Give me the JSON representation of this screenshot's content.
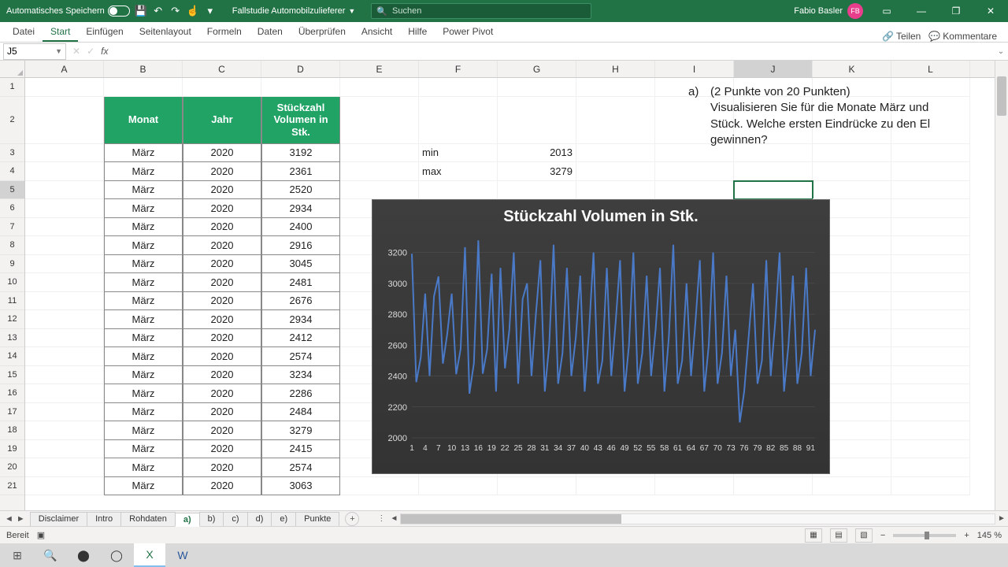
{
  "titlebar": {
    "autosave_label": "Automatisches Speichern",
    "doc_name": "Fallstudie Automobilzulieferer",
    "search_placeholder": "Suchen",
    "user_name": "Fabio Basler",
    "user_initials": "FB"
  },
  "ribbon": {
    "tabs": [
      "Datei",
      "Start",
      "Einfügen",
      "Seitenlayout",
      "Formeln",
      "Daten",
      "Überprüfen",
      "Ansicht",
      "Hilfe",
      "Power Pivot"
    ],
    "share": "Teilen",
    "comments": "Kommentare"
  },
  "formula": {
    "name_box": "J5",
    "value": ""
  },
  "columns": [
    {
      "l": "A",
      "w": 100
    },
    {
      "l": "B",
      "w": 100
    },
    {
      "l": "C",
      "w": 100
    },
    {
      "l": "D",
      "w": 100
    },
    {
      "l": "E",
      "w": 100
    },
    {
      "l": "F",
      "w": 100
    },
    {
      "l": "G",
      "w": 100
    },
    {
      "l": "H",
      "w": 100
    },
    {
      "l": "I",
      "w": 100
    },
    {
      "l": "J",
      "w": 100
    },
    {
      "l": "K",
      "w": 100
    },
    {
      "l": "L",
      "w": 100
    }
  ],
  "headers": {
    "b": "Monat",
    "c": "Jahr",
    "d": "Stückzahl Volumen in Stk."
  },
  "stats": {
    "min_label": "min",
    "min_val": "2013",
    "max_label": "max",
    "max_val": "3279"
  },
  "question": {
    "marker": "a)",
    "line1": "(2 Punkte von 20 Punkten)",
    "line2": "Visualisieren Sie für die Monate März und",
    "line3": "Stück. Welche ersten Eindrücke zu den El",
    "line4": "gewinnen?"
  },
  "table_rows": [
    {
      "m": "März",
      "j": "2020",
      "v": "3192"
    },
    {
      "m": "März",
      "j": "2020",
      "v": "2361"
    },
    {
      "m": "März",
      "j": "2020",
      "v": "2520"
    },
    {
      "m": "März",
      "j": "2020",
      "v": "2934"
    },
    {
      "m": "März",
      "j": "2020",
      "v": "2400"
    },
    {
      "m": "März",
      "j": "2020",
      "v": "2916"
    },
    {
      "m": "März",
      "j": "2020",
      "v": "3045"
    },
    {
      "m": "März",
      "j": "2020",
      "v": "2481"
    },
    {
      "m": "März",
      "j": "2020",
      "v": "2676"
    },
    {
      "m": "März",
      "j": "2020",
      "v": "2934"
    },
    {
      "m": "März",
      "j": "2020",
      "v": "2412"
    },
    {
      "m": "März",
      "j": "2020",
      "v": "2574"
    },
    {
      "m": "März",
      "j": "2020",
      "v": "3234"
    },
    {
      "m": "März",
      "j": "2020",
      "v": "2286"
    },
    {
      "m": "März",
      "j": "2020",
      "v": "2484"
    },
    {
      "m": "März",
      "j": "2020",
      "v": "3279"
    },
    {
      "m": "März",
      "j": "2020",
      "v": "2415"
    },
    {
      "m": "März",
      "j": "2020",
      "v": "2574"
    },
    {
      "m": "März",
      "j": "2020",
      "v": "3063"
    }
  ],
  "chart_data": {
    "type": "line",
    "title": "Stückzahl Volumen in Stk.",
    "ylabel": "",
    "xlabel": "",
    "ylim": [
      2000,
      3300
    ],
    "yticks": [
      2000,
      2200,
      2400,
      2600,
      2800,
      3000,
      3200
    ],
    "xticks": [
      1,
      4,
      7,
      10,
      13,
      16,
      19,
      22,
      25,
      28,
      31,
      34,
      37,
      40,
      43,
      46,
      49,
      52,
      55,
      58,
      61,
      64,
      67,
      70,
      73,
      76,
      79,
      82,
      85,
      88,
      91
    ],
    "values": [
      3192,
      2361,
      2520,
      2934,
      2400,
      2916,
      3045,
      2481,
      2676,
      2934,
      2412,
      2574,
      3234,
      2286,
      2484,
      3279,
      2415,
      2574,
      3063,
      2300,
      3100,
      2450,
      2700,
      3200,
      2350,
      2900,
      3000,
      2400,
      2800,
      3150,
      2300,
      2600,
      3250,
      2350,
      2550,
      3100,
      2400,
      2650,
      3050,
      2300,
      2700,
      3200,
      2350,
      2500,
      3100,
      2400,
      2750,
      3150,
      2300,
      2600,
      3200,
      2350,
      2550,
      3050,
      2400,
      2700,
      3100,
      2300,
      2650,
      3250,
      2350,
      2500,
      3000,
      2400,
      2750,
      3150,
      2300,
      2600,
      3200,
      2350,
      2550,
      3050,
      2400,
      2700,
      2100,
      2300,
      2650,
      3000,
      2350,
      2500,
      3150,
      2400,
      2750,
      3200,
      2300,
      2600,
      3050,
      2350,
      2550,
      3100,
      2400,
      2700
    ]
  },
  "sheets": [
    "Disclaimer",
    "Intro",
    "Rohdaten",
    "a)",
    "b)",
    "c)",
    "d)",
    "e)",
    "Punkte"
  ],
  "active_sheet": "a)",
  "status": {
    "ready": "Bereit",
    "zoom": "145 %"
  }
}
